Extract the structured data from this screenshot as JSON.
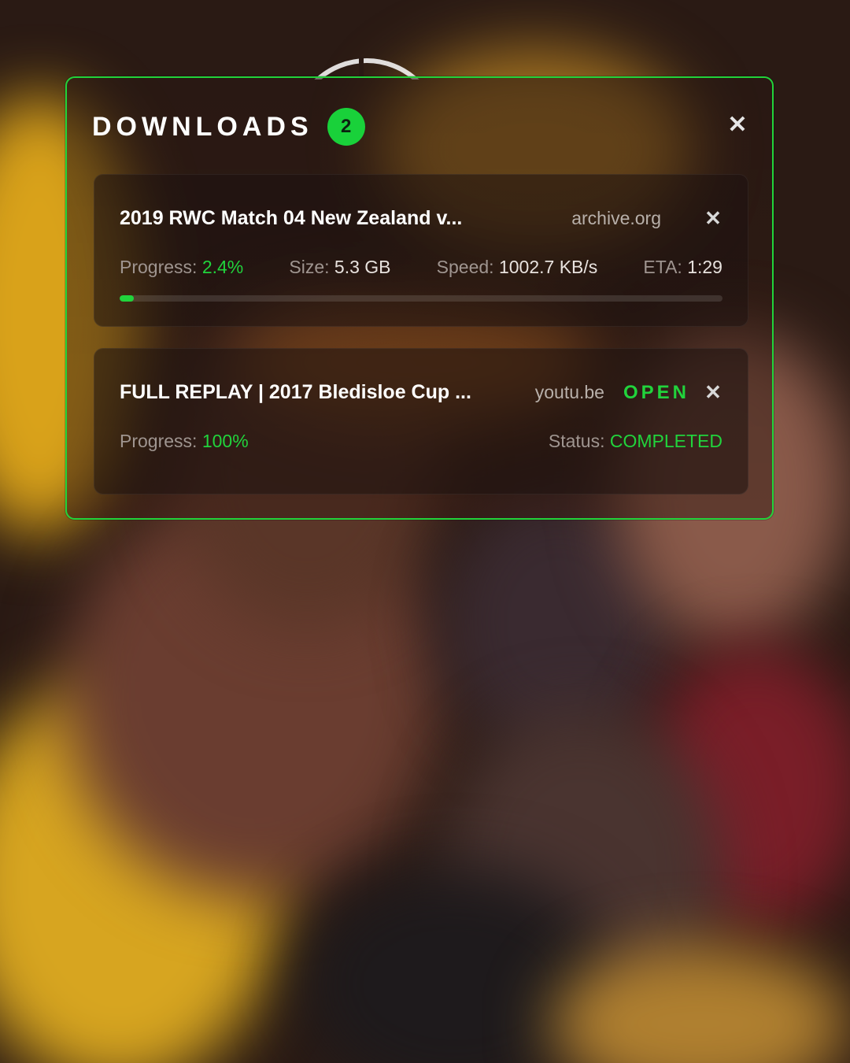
{
  "panel": {
    "title": "DOWNLOADS",
    "count": "2",
    "close_icon": "close-icon"
  },
  "colors": {
    "accent": "#21d33c",
    "text": "#ffffff",
    "muted": "#9f9590"
  },
  "downloads": [
    {
      "name": "2019 RWC Match 04 New Zealand v...",
      "source": "archive.org",
      "progress_label": "Progress:",
      "progress_value": "2.4%",
      "progress_fraction": 0.024,
      "size_label": "Size:",
      "size_value": "5.3 GB",
      "speed_label": "Speed:",
      "speed_value": "1002.7 KB/s",
      "eta_label": "ETA:",
      "eta_value": "1:29"
    },
    {
      "name": "FULL REPLAY | 2017 Bledisloe Cup ...",
      "source": "youtu.be",
      "open_label": "OPEN",
      "progress_label": "Progress:",
      "progress_value": "100%",
      "status_label": "Status:",
      "status_value": "COMPLETED"
    }
  ]
}
